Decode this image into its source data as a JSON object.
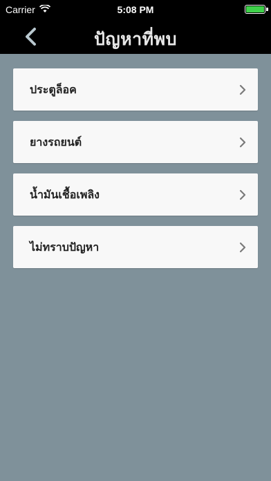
{
  "status": {
    "carrier": "Carrier",
    "time": "5:08 PM"
  },
  "nav": {
    "title": "ปัญหาที่พบ"
  },
  "items": [
    {
      "label": "ประตูล็อค"
    },
    {
      "label": "ยางรถยนต์"
    },
    {
      "label": "น้ำมันเชื้อเพลิง"
    },
    {
      "label": "ไม่ทราบปัญหา"
    }
  ],
  "colors": {
    "background": "#7f919a",
    "bar": "#000000",
    "card": "#f8f8f8",
    "battery": "#3fd14a"
  }
}
